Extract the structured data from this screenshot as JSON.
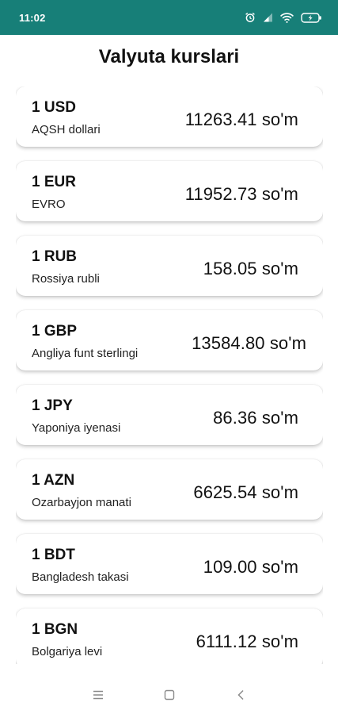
{
  "status_bar": {
    "time": "11:02",
    "icons": [
      "alarm-icon",
      "signal-icon",
      "wifi-icon",
      "battery-icon"
    ],
    "background": "#177f78"
  },
  "header": {
    "title": "Valyuta kurslari"
  },
  "currencies": [
    {
      "code": "1 USD",
      "name": "AQSH dollari",
      "rate": "11263.41 so'm"
    },
    {
      "code": "1 EUR",
      "name": "EVRO",
      "rate": "11952.73 so'm"
    },
    {
      "code": "1 RUB",
      "name": "Rossiya rubli",
      "rate": "158.05 so'm"
    },
    {
      "code": "1 GBP",
      "name": "Angliya funt sterlingi",
      "rate": "13584.80 so'm"
    },
    {
      "code": "1 JPY",
      "name": "Yaponiya iyenasi",
      "rate": "86.36 so'm"
    },
    {
      "code": "1 AZN",
      "name": "Ozarbayjon manati",
      "rate": "6625.54 so'm"
    },
    {
      "code": "1 BDT",
      "name": "Bangladesh takasi",
      "rate": "109.00 so'm"
    },
    {
      "code": "1 BGN",
      "name": "Bolgariya levi",
      "rate": "6111.12 so'm"
    }
  ],
  "nav_bar": {
    "buttons": [
      "menu-icon",
      "home-icon",
      "back-icon"
    ]
  }
}
